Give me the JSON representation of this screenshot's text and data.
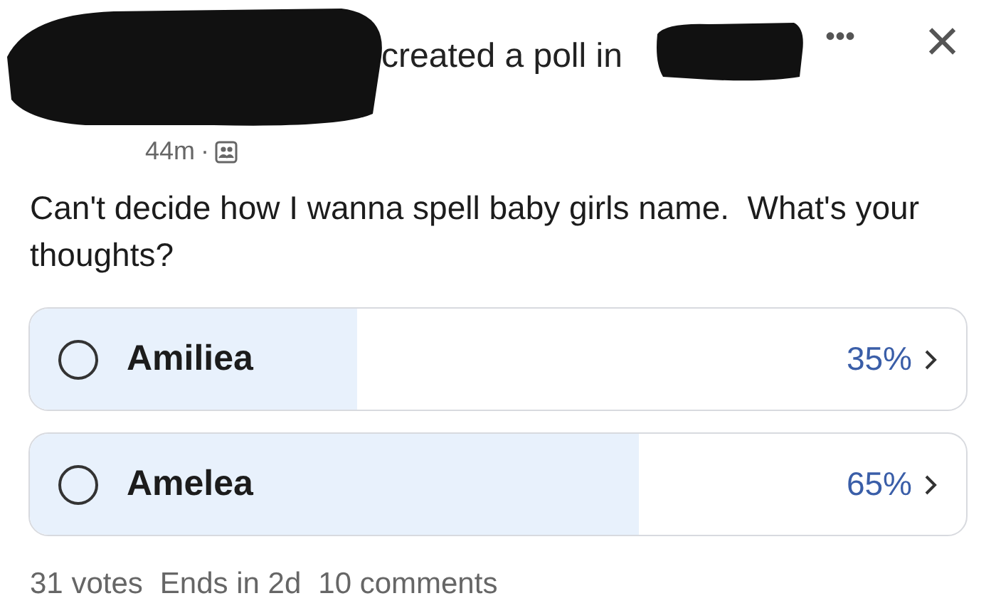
{
  "header": {
    "action": "created a poll in",
    "time": "44m",
    "separator": "·",
    "more": "•••",
    "close": "×"
  },
  "question": "Can't decide how I wanna spell baby girls name.  What's your thoughts?",
  "options": [
    {
      "label": "Amiliea",
      "percent": "35%",
      "level": 0.35,
      "selected": false
    },
    {
      "label": "Amelea",
      "percent": "65%",
      "level": 0.65,
      "selected": false
    }
  ],
  "footer": [
    "31 votes",
    "Ends in 2d",
    "10 comments"
  ]
}
